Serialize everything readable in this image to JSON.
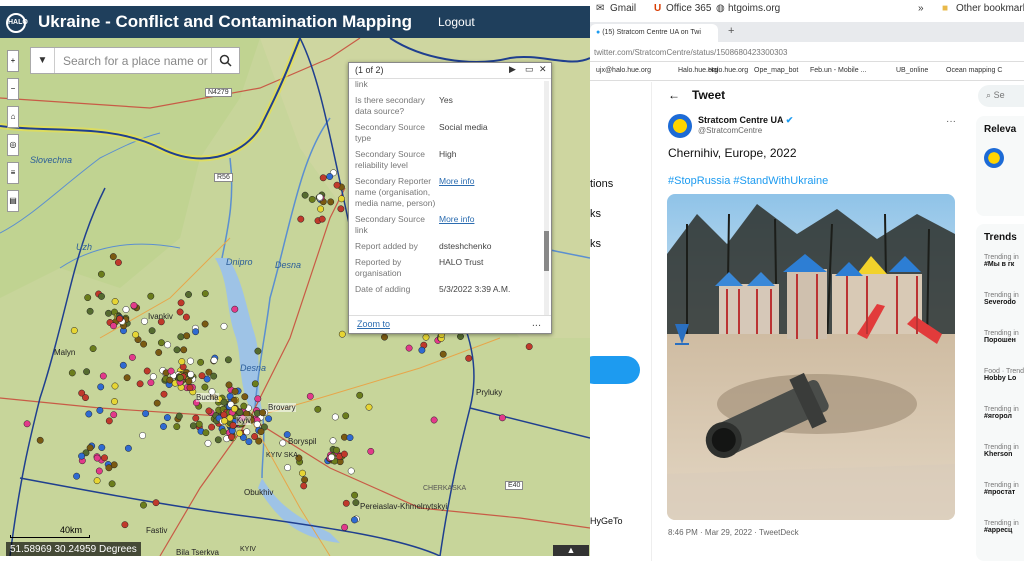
{
  "map_app": {
    "logo": "HALO",
    "title": "Ukraine - Conflict and Contamination Mapping",
    "logout": "Logout",
    "search_placeholder": "Search for a place name or",
    "coords": "51.58969 30.24959 Degrees",
    "scale": "40km",
    "place_labels": [
      "Slovechna",
      "Uzh",
      "Dnipro",
      "Desna",
      "Desna",
      "Ivankiv",
      "Malyn",
      "Brovary",
      "Bucha",
      "Kyiv",
      "Boryspil",
      "KYIV SKA",
      "Obukhiv",
      "Fastiv",
      "Pereiaslav-Khmelnytskyi",
      "Pryluky",
      "CHERKASKA",
      "Bila Tserkva",
      "KYIV"
    ],
    "highway_labels": [
      "N4279",
      "R56",
      "E40"
    ],
    "colors": {
      "header": "#1f3f5c",
      "map": "#c9d49a",
      "border": "#1f3f8f"
    }
  },
  "popup": {
    "counter": "(1 of 2)",
    "rows": [
      {
        "k": "link",
        "v": ""
      },
      {
        "k": "Is there secondary data source?",
        "v": "Yes"
      },
      {
        "k": "Secondary Source type",
        "v": "Social media"
      },
      {
        "k": "Secondary Source reliability level",
        "v": "High"
      },
      {
        "k": "Secondary Reporter name (organisation, media name, person)",
        "v": "More info"
      },
      {
        "k": "Secondary Source link",
        "v": "More info"
      },
      {
        "k": "Report added by",
        "v": "dsteshchenko"
      },
      {
        "k": "Reported by organisation",
        "v": "HALO Trust"
      },
      {
        "k": "Date of adding",
        "v": "5/3/2022 3:39 A.M."
      }
    ],
    "zoom": "Zoom to",
    "more": "..."
  },
  "browser": {
    "bookmarks_top": [
      "Gmail",
      "Office 365",
      "htgoims.org",
      "»",
      "Other bookmarks"
    ],
    "tab": "(15) Stratcom Centre UA on Twi",
    "url": "twitter.com/StratcomCentre/status/1508680423300303",
    "bookmark_items": [
      "ujx@halo.hue.org",
      "Halo.hue.org",
      "Halo.hue.org",
      "Ope_map_bot",
      "Feb.un - Mobile ...",
      "UB_online",
      "Ocean mapping C"
    ]
  },
  "twitter": {
    "left_nav": [
      "tions",
      "ks",
      "ks"
    ],
    "tweet_button": "t",
    "account": "HyGeTo",
    "header": "Tweet",
    "author": "Stratcom Centre UA",
    "handle": "@StratcomCentre",
    "text": "Chernihiv, Europe, 2022",
    "hashtags": "#StopRussia #StandWithUkraine",
    "meta": "8:46 PM · Mar 29, 2022 · TweetDeck",
    "search": "Se",
    "relevant": "Releva",
    "trends_title": "Trends",
    "trends": [
      {
        "s": "Trending in",
        "n": "#Мы в гк"
      },
      {
        "s": "Trending in",
        "n": "Severodo"
      },
      {
        "s": "Trending in",
        "n": "Порошен"
      },
      {
        "s": "Food · Trending",
        "n": "Hobby Lo"
      },
      {
        "s": "Trending in",
        "n": "#ягорол"
      },
      {
        "s": "Trending in",
        "n": "Kherson"
      },
      {
        "s": "Trending in",
        "n": "#простат"
      },
      {
        "s": "Trending in",
        "n": "#арресц"
      }
    ]
  }
}
